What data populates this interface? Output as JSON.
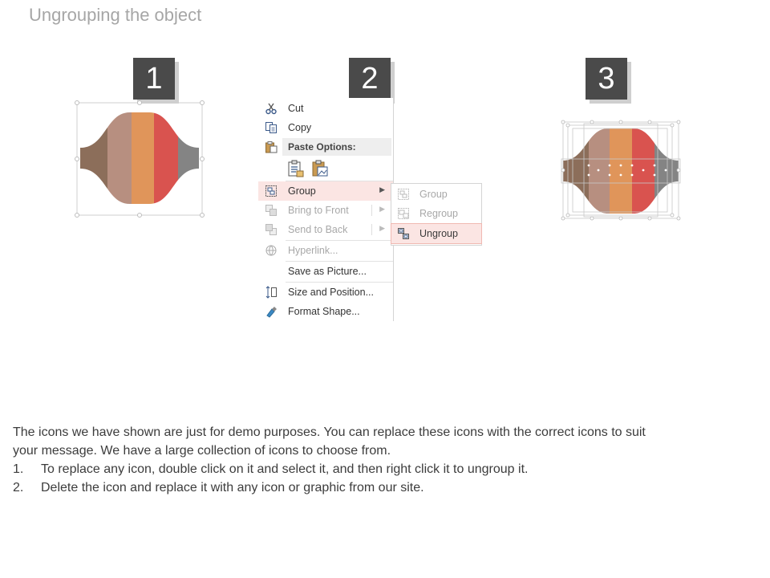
{
  "slide": {
    "title": "Ungrouping the object"
  },
  "steps": [
    {
      "number": "1"
    },
    {
      "number": "2"
    },
    {
      "number": "3"
    }
  ],
  "colors": {
    "band1": "#8c6e5a",
    "band2": "#b78f80",
    "band3": "#e0955a",
    "band4": "#d9534f",
    "band5": "#848484",
    "menu_highlight": "#fbe5e3",
    "badge": "#4a4a4a"
  },
  "context_menu": {
    "cut": "Cut",
    "copy": "Copy",
    "paste_options": "Paste Options:",
    "group": "Group",
    "bring_to_front": "Bring to Front",
    "send_to_back": "Send to Back",
    "hyperlink": "Hyperlink...",
    "save_as_picture": "Save as Picture...",
    "size_and_position": "Size and Position...",
    "format_shape": "Format Shape..."
  },
  "submenu": {
    "group": "Group",
    "regroup": "Regroup",
    "ungroup": "Ungroup"
  },
  "description": {
    "intro_line1": "The icons we have shown are just for demo purposes. You can replace these icons with the correct icons to suit",
    "intro_line2": "your message. We have a large collection of icons to choose from.",
    "items": [
      {
        "num": "1.",
        "text": "To replace any icon, double click on it and select it, and then right click it to ungroup it."
      },
      {
        "num": "2.",
        "text": "Delete the icon and replace it with any icon or graphic from our site."
      }
    ]
  }
}
